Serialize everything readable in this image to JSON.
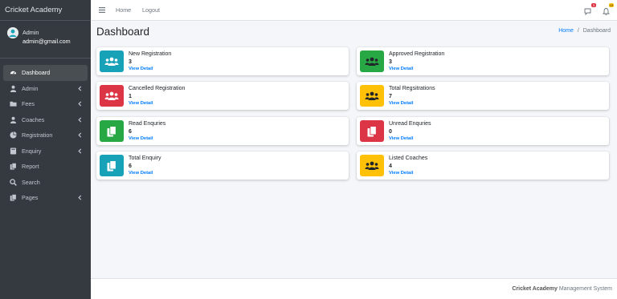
{
  "brand": {
    "name": "Cricket Academy"
  },
  "user": {
    "name": "Admin",
    "email": "admin@gmail.com"
  },
  "sidebar": {
    "items": [
      {
        "label": "Dashboard",
        "icon": "tachometer-icon",
        "active": true,
        "has_children": false
      },
      {
        "label": "Admin",
        "icon": "user-icon",
        "active": false,
        "has_children": true
      },
      {
        "label": "Fees",
        "icon": "folder-icon",
        "active": false,
        "has_children": true
      },
      {
        "label": "Coaches",
        "icon": "user-icon",
        "active": false,
        "has_children": true
      },
      {
        "label": "Registration",
        "icon": "pie-chart-icon",
        "active": false,
        "has_children": true
      },
      {
        "label": "Enquiry",
        "icon": "book-icon",
        "active": false,
        "has_children": true
      },
      {
        "label": "Report",
        "icon": "copy-icon",
        "active": false,
        "has_children": false
      },
      {
        "label": "Search",
        "icon": "search-icon",
        "active": false,
        "has_children": false
      },
      {
        "label": "Pages",
        "icon": "copy-icon",
        "active": false,
        "has_children": true
      }
    ]
  },
  "topbar": {
    "menu_icon": "bars-icon",
    "links": [
      "Home",
      "Logout"
    ],
    "messages_badge": "3",
    "notifications_badge": "15"
  },
  "header": {
    "title": "Dashboard"
  },
  "breadcrumb": {
    "home": "Home",
    "separator": "/",
    "current": "Dashboard"
  },
  "cards": [
    {
      "title": "New Registration",
      "value": "3",
      "link": "View Detail",
      "color": "#17a2b8",
      "icon": "users-icon"
    },
    {
      "title": "Approved Registration",
      "value": "3",
      "link": "View Detail",
      "color": "#28a745",
      "icon": "users-icon"
    },
    {
      "title": "Cancelled Registration",
      "value": "1",
      "link": "View Detail",
      "color": "#dc3545",
      "icon": "users-icon"
    },
    {
      "title": "Total Regsitrations",
      "value": "7",
      "link": "View Detail",
      "color": "#ffc107",
      "icon": "users-icon"
    },
    {
      "title": "Read Enquries",
      "value": "6",
      "link": "View Detail",
      "color": "#28a745",
      "icon": "copy-icon"
    },
    {
      "title": "Unread Enquries",
      "value": "0",
      "link": "View Detail",
      "color": "#dc3545",
      "icon": "copy-icon"
    },
    {
      "title": "Total Enquiry",
      "value": "6",
      "link": "View Detail",
      "color": "#17a2b8",
      "icon": "copy-icon"
    },
    {
      "title": "Listed Coaches",
      "value": "4",
      "link": "View Detail",
      "color": "#ffc107",
      "icon": "users-icon"
    }
  ],
  "footer": {
    "brand": "Cricket Academy",
    "text": "Management System"
  },
  "colors": {
    "sidebar_bg": "#343a40",
    "primary": "#007bff",
    "info": "#17a2b8",
    "success": "#28a745",
    "danger": "#dc3545",
    "warning": "#ffc107"
  }
}
